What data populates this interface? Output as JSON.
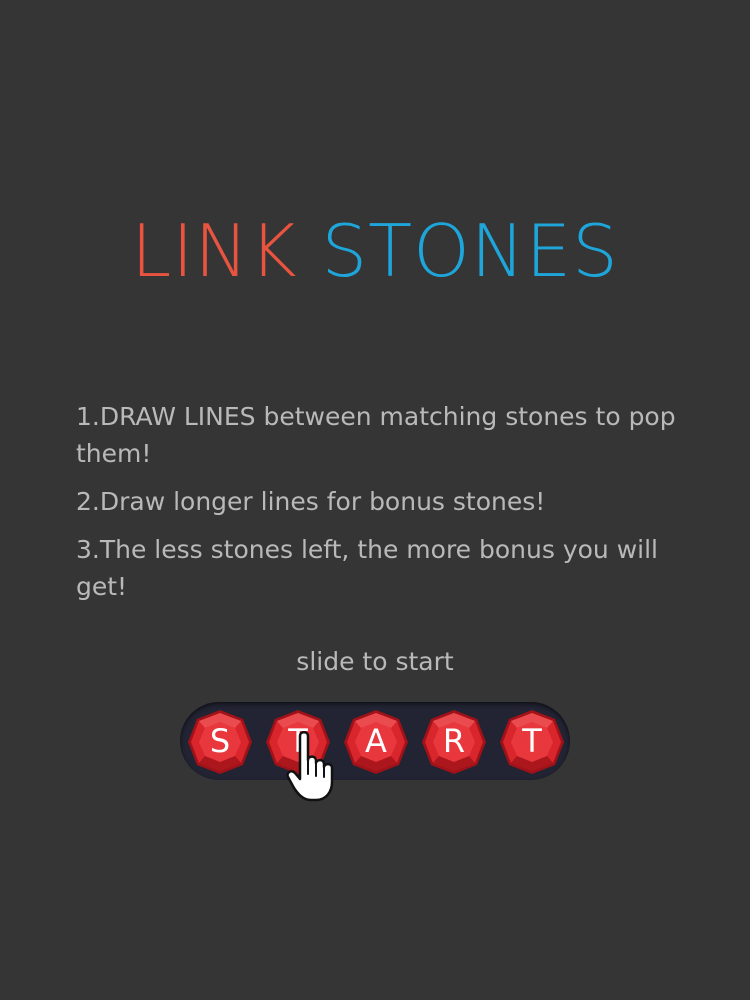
{
  "title": {
    "word1": "LINK",
    "word2": "STONES",
    "color1": "#e8543f",
    "color2": "#1ea6db"
  },
  "instructions": [
    "1.DRAW LINES between matching stones to pop them!",
    "2.Draw longer lines for bonus stones!",
    "3.The less stones left, the more bonus you will get!"
  ],
  "slide_label": "slide to start",
  "slider": {
    "letters": [
      "S",
      "T",
      "A",
      "R",
      "T"
    ],
    "stone_color": "#d8262c",
    "cursor_icon": "pointing-hand-icon"
  }
}
